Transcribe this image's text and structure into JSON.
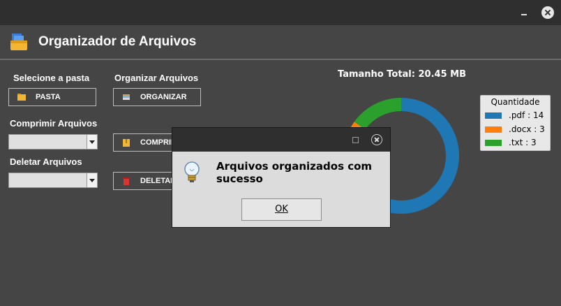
{
  "app": {
    "title": "Organizador de Arquivos"
  },
  "labels": {
    "select_folder": "Selecione a pasta",
    "organize": "Organizar Arquivos",
    "compress": "Comprimir Arquivos",
    "delete": "Deletar Arquivos"
  },
  "buttons": {
    "pasta": "PASTA",
    "organizar": "ORGANIZAR",
    "comprimir": "COMPRIM",
    "deletar": "DELETAR"
  },
  "combos": {
    "compress_value": "",
    "delete_value": ""
  },
  "chart_data": {
    "type": "pie",
    "title": "Tamanho Total: 20.45 MB",
    "legend_title": "Quantidade",
    "legend_position": "top-right",
    "slices": [
      {
        "label": ".pdf : 14",
        "value": 14,
        "color": "#1f77b4"
      },
      {
        "label": ".docx : 3",
        "value": 3,
        "color": "#ff7f0e"
      },
      {
        "label": ".txt : 3",
        "value": 3,
        "color": "#2ca02c"
      }
    ]
  },
  "dialog": {
    "message": "Arquivos organizados com sucesso",
    "ok_label": "OK",
    "icon": "lightbulb-icon"
  },
  "colors": {
    "background": "#454545",
    "titlebar": "#2f2f2f",
    "accent_logo": "#3a7bd5"
  }
}
